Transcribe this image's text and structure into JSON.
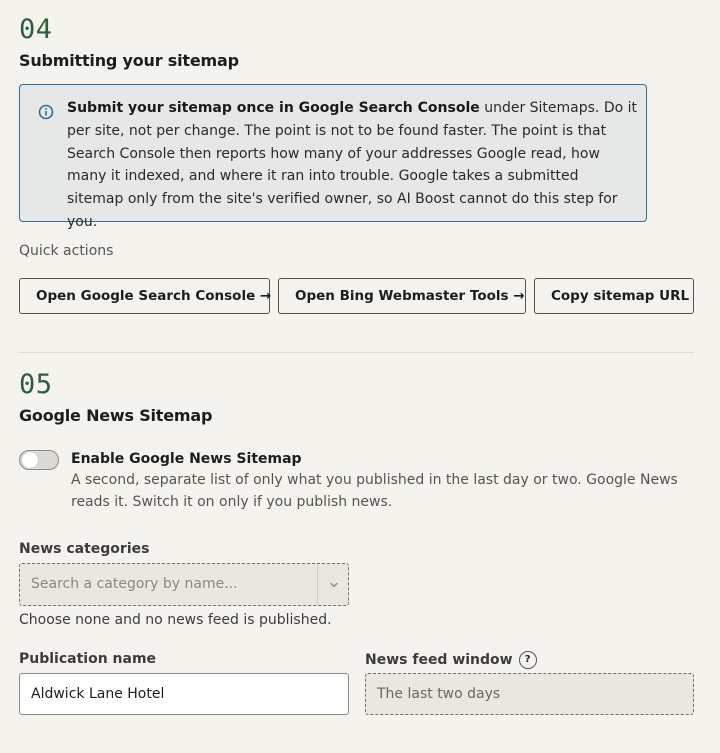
{
  "sitemap_submit": {
    "step_number": "04",
    "title": "Submitting your sitemap",
    "notice": {
      "icon": "info-icon",
      "bold_text": "Submit your sitemap once in Google Search Console",
      "body_text": " under Sitemaps. Do it per site, not per change. The point is not to be found faster. The point is that Search Console then reports how many of your addresses Google read, how many it indexed, and where it ran into trouble. Google takes a submitted sitemap only from the site's verified owner, so AI Boost cannot do this step for you.",
      "accent_color": "#2f6f94"
    },
    "quick_actions_label": "Quick actions",
    "buttons": {
      "google": "Open Google Search Console →",
      "bing": "Open Bing Webmaster Tools →",
      "copy": "Copy sitemap URL"
    }
  },
  "news_sitemap": {
    "step_number": "05",
    "title": "Google News Sitemap",
    "toggle": {
      "label": "Enable Google News Sitemap",
      "description": "A second, separate list of only what you published in the last day or two. Google News reads it. Switch it on only if you publish news.",
      "enabled": false
    },
    "categories": {
      "label": "News categories",
      "placeholder": "Search a category by name...",
      "hint": "Choose none and no news feed is published."
    },
    "publication_name": {
      "label": "Publication name",
      "value": "Aldwick Lane Hotel"
    },
    "feed_window": {
      "label": "News feed window",
      "help": "?",
      "value": "The last two days"
    }
  },
  "colors": {
    "step_number": "#2e5e3a",
    "background": "#f5f3ee"
  }
}
